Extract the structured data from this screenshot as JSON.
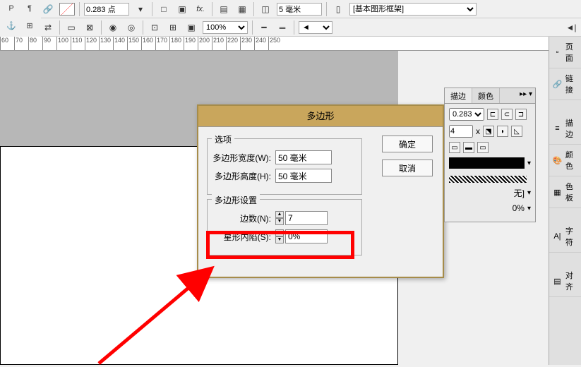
{
  "toolbar1": {
    "stroke_size": "0.283 点",
    "fx": "fx.",
    "spacing": "5 毫米",
    "frame_select": "[基本图形框架]"
  },
  "toolbar2": {
    "zoom": "100%"
  },
  "ruler": [
    "60",
    "70",
    "80",
    "90",
    "100",
    "110",
    "120",
    "130",
    "140",
    "150",
    "160",
    "170",
    "180",
    "190",
    "200",
    "210",
    "220",
    "230",
    "240",
    "250"
  ],
  "dialog": {
    "title": "多边形",
    "ok": "确定",
    "cancel": "取消",
    "options_label": "选项",
    "width_label": "多边形宽度(W):",
    "width_value": "50 毫米",
    "height_label": "多边形高度(H):",
    "height_value": "50 毫米",
    "settings_label": "多边形设置",
    "sides_label": "边数(N):",
    "sides_value": "7",
    "inset_label": "星形内陷(S):",
    "inset_value": "0%"
  },
  "side_panel": {
    "tab1": "描边",
    "tab2": "颜色",
    "stroke_weight": "0.283",
    "corner_val": "4",
    "x_label": "x",
    "align_label": "无]",
    "pct": "0%"
  },
  "right_bar": {
    "pages": "页面",
    "links": "链接",
    "stroke": "描边",
    "color": "颜色",
    "swatch": "色板",
    "char": "字符",
    "align": "对齐"
  }
}
